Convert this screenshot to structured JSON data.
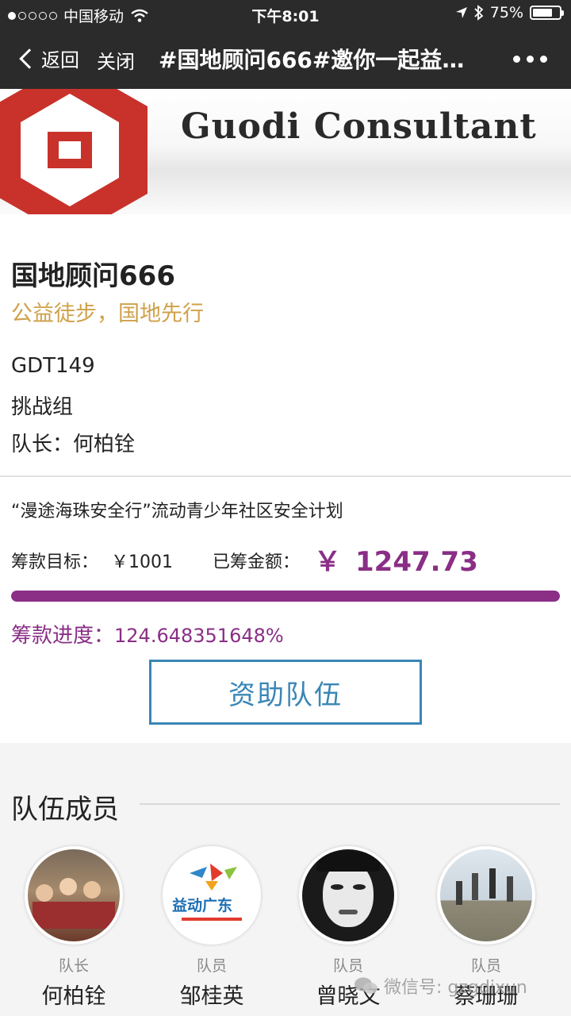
{
  "status_bar": {
    "carrier": "中国移动",
    "time": "下午8:01",
    "battery_percent": "75%",
    "battery_level": 0.75
  },
  "nav": {
    "back_label": "返回",
    "close_label": "关闭",
    "title": "#国地顾问666#邀你一起益…"
  },
  "banner": {
    "brand_text": "Guodi Consultant"
  },
  "team": {
    "name": "国地顾问666",
    "slogan": "公益徒步，国地先行",
    "code": "GDT149",
    "group": "挑战组",
    "captain": "队长：何柏铨"
  },
  "fundraising": {
    "project": "“漫途海珠安全行”流动青少年社区安全计划",
    "goal_label": "筹款目标：",
    "goal_value": "￥1001",
    "raised_label": "已筹金额：",
    "raised_currency": "￥",
    "raised_value": "1247.73",
    "progress_label": "筹款进度：",
    "progress_value": "124.648351648%",
    "progress_fraction": 1.0,
    "support_button": "资助队伍"
  },
  "members": {
    "title": "队伍成员",
    "list": [
      {
        "role": "队长",
        "name": "何柏铨",
        "avatar": "group-photo"
      },
      {
        "role": "队员",
        "name": "邹桂英",
        "avatar": "yidong-guangdong-logo",
        "logo_text": "益动广东"
      },
      {
        "role": "队员",
        "name": "曾晓文",
        "avatar": "portrait-photo"
      },
      {
        "role": "队员",
        "name": "蔡珊珊",
        "avatar": "jumping-photo"
      }
    ]
  },
  "watermark": {
    "text": "微信号: gzgdixun"
  },
  "colors": {
    "accent_purple": "#8a2e86",
    "slogan_gold": "#cfa14a",
    "button_blue": "#3a86b6",
    "nav_bg": "#2b2b2b",
    "logo_red": "#c8322a"
  }
}
